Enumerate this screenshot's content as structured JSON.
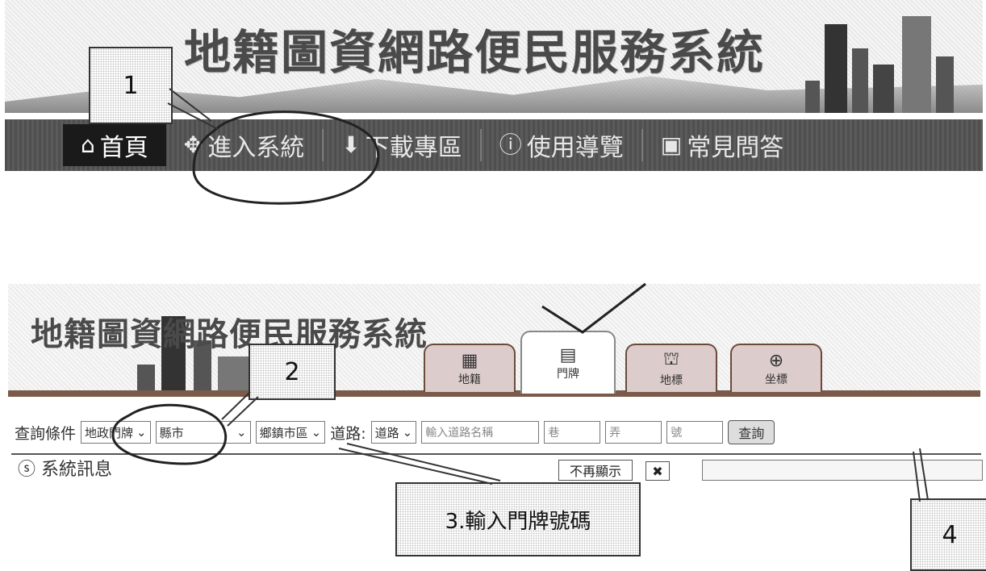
{
  "top": {
    "site_title": "地籍圖資網路便民服務系統",
    "nav": [
      {
        "label": "首頁",
        "icon": "home-icon"
      },
      {
        "label": "進入系統",
        "icon": "enter-system-icon"
      },
      {
        "label": "下載專區",
        "icon": "download-icon"
      },
      {
        "label": "使用導覽",
        "icon": "guide-icon"
      },
      {
        "label": "常見問答",
        "icon": "faq-icon"
      }
    ]
  },
  "bottom": {
    "site_title": "地籍圖資網路便民服務系統",
    "tabs": [
      {
        "label": "地籍",
        "icon": "cadastre-icon"
      },
      {
        "label": "門牌",
        "icon": "house-number-icon"
      },
      {
        "label": "地標",
        "icon": "landmark-icon"
      },
      {
        "label": "坐標",
        "icon": "coordinate-icon"
      }
    ],
    "search": {
      "condition_label": "查詢條件",
      "condition_value": "地政門牌",
      "county_value": "縣市",
      "township_value": "鄉鎮市區",
      "road_label": "道路:",
      "road_type_value": "道路",
      "road_name_placeholder": "輸入道路名稱",
      "lane_placeholder": "巷",
      "alley_placeholder": "弄",
      "number_placeholder": "號",
      "query_button": "查詢"
    },
    "system_info": "系統訊息",
    "hide_button": "不再顯示",
    "close_button": "✖"
  },
  "callouts": [
    "1",
    "2",
    "3.輸入門牌號碼",
    "4"
  ],
  "colors": {
    "navbar": "#555555",
    "nav_active": "#1a1a1a",
    "tab_border": "#6b4a3a"
  }
}
